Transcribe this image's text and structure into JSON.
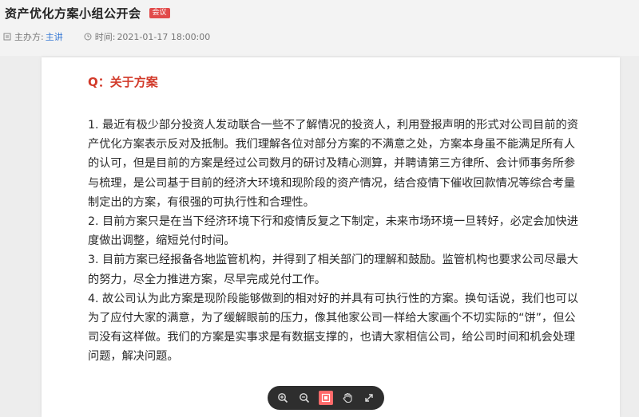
{
  "header": {
    "title": "资产优化方案小组公开会",
    "badge": "会议",
    "host_label": "主办方:",
    "host_value": "主讲",
    "time_label": "时间:",
    "time_value": "2021-01-17 18:00:00"
  },
  "document": {
    "section_title": "Q：关于方案",
    "paragraphs": [
      "1. 最近有极少部分投资人发动联合一些不了解情况的投资人，利用登报声明的形式对公司目前的资产优化方案表示反对及抵制。我们理解各位对部分方案的不满意之处，方案本身虽不能满足所有人的认可，但是目前的方案是经过公司数月的研讨及精心测算，并聘请第三方律所、会计师事务所参与梳理，是公司基于目前的经济大环境和现阶段的资产情况，结合疫情下催收回款情况等综合考量制定出的方案，有很强的可执行性和合理性。",
      "2. 目前方案只是在当下经济环境下行和疫情反复之下制定，未来市场环境一旦转好，必定会加快进度做出调整，缩短兑付时间。",
      "3. 目前方案已经报备各地监管机构，并得到了相关部门的理解和鼓励。监管机构也要求公司尽最大的努力，尽全力推进方案，尽早完成兑付工作。",
      "4. 故公司认为此方案是现阶段能够做到的相对好的并具有可执行性的方案。换句话说，我们也可以为了应付大家的满意，为了缓解眼前的压力，像其他家公司一样给大家画个不切实际的“饼”，但公司没有这样做。我们的方案是实事求是有数据支撑的，也请大家相信公司，给公司时间和机会处理问题，解决问题。"
    ]
  },
  "toolbar": {
    "icons": [
      "zoom-in-icon",
      "zoom-out-icon",
      "fit-page-icon",
      "hand-icon",
      "fullscreen-icon"
    ]
  },
  "colors": {
    "accent_red": "#d23a2a",
    "link_blue": "#3a7bd5",
    "badge_red": "#e14a4a"
  }
}
